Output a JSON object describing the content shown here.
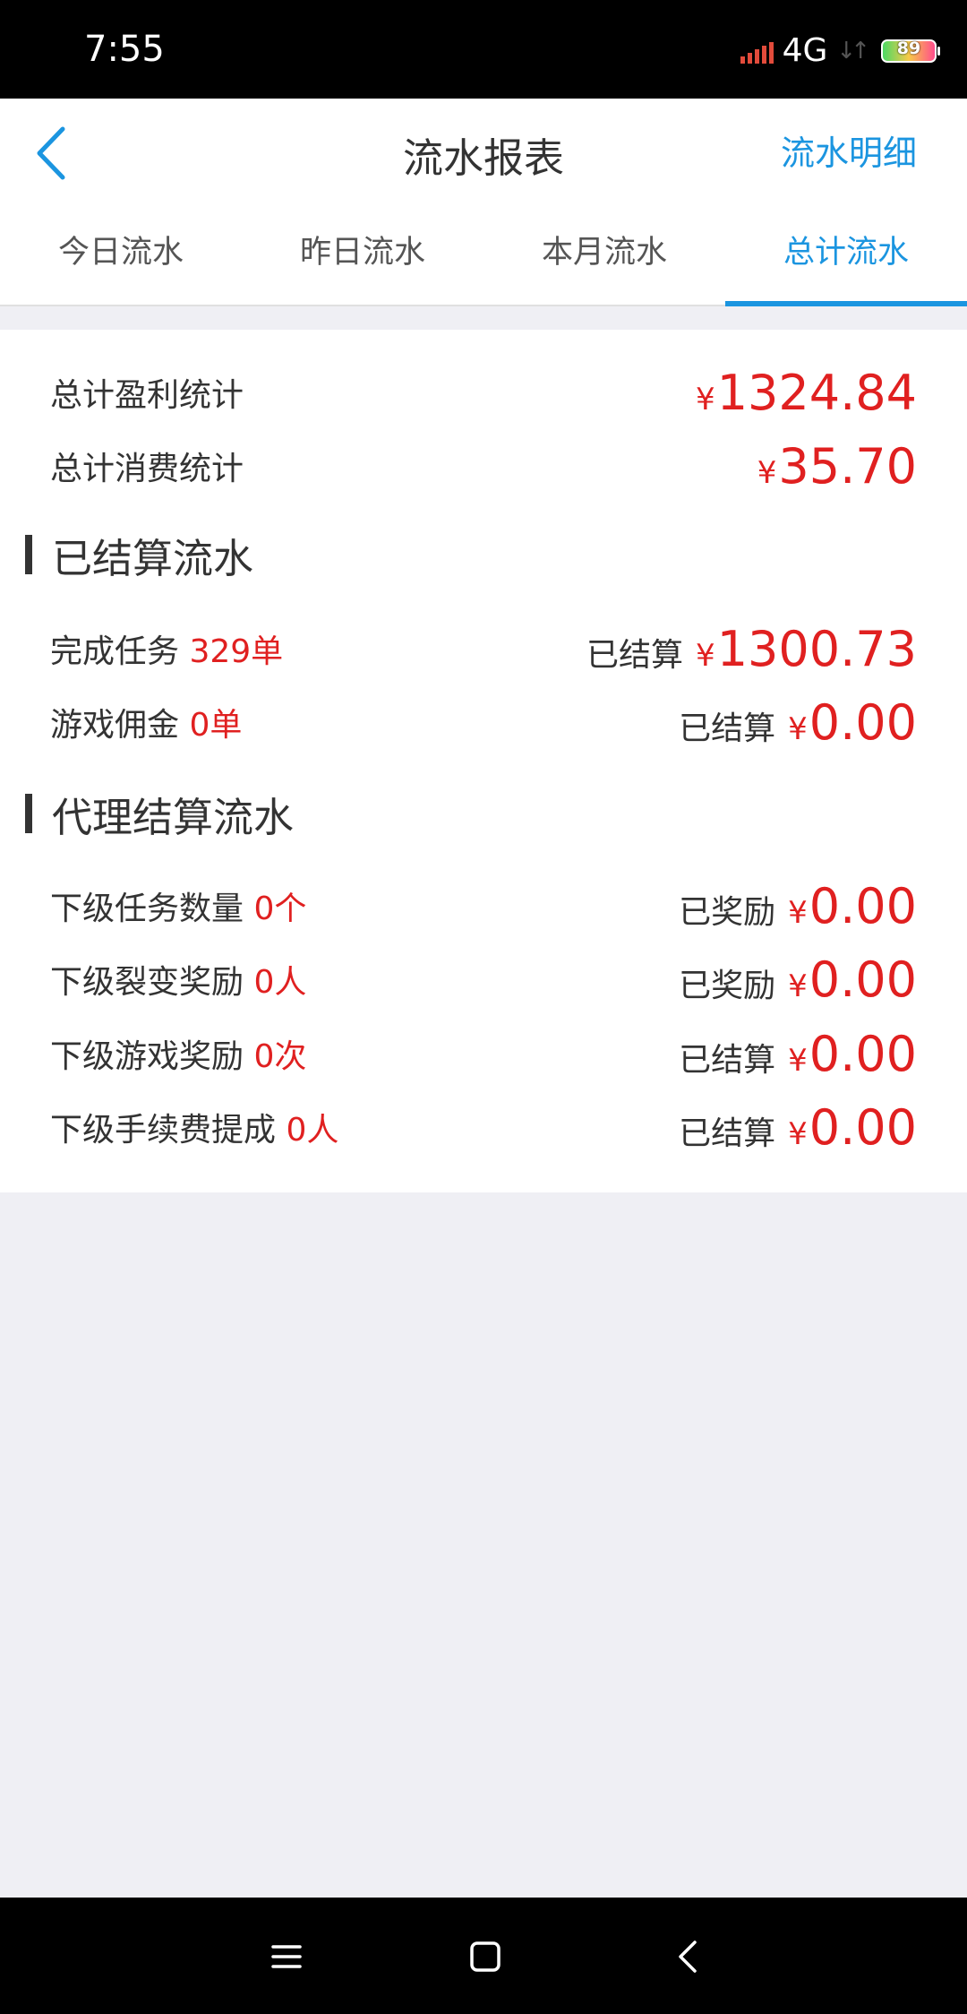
{
  "status_bar": {
    "time": "7:55",
    "network": "4G",
    "battery": "89"
  },
  "header": {
    "title": "流水报表",
    "detail_link": "流水明细",
    "back_icon": "chevron-left-icon"
  },
  "tabs": [
    {
      "label": "今日流水",
      "active": false
    },
    {
      "label": "昨日流水",
      "active": false
    },
    {
      "label": "本月流水",
      "active": false
    },
    {
      "label": "总计流水",
      "active": true
    }
  ],
  "summary": {
    "profit": {
      "label": "总计盈利统计",
      "currency": "¥",
      "amount": "1324.84"
    },
    "consumption": {
      "label": "总计消费统计",
      "currency": "¥",
      "amount": "35.70"
    }
  },
  "settled_section": {
    "title": "已结算流水",
    "rows": [
      {
        "label": "完成任务",
        "count": "329单",
        "status": "已结算",
        "currency": "¥",
        "amount": "1300.73"
      },
      {
        "label": "游戏佣金",
        "count": "0单",
        "status": "已结算",
        "currency": "¥",
        "amount": "0.00"
      }
    ]
  },
  "agent_section": {
    "title": "代理结算流水",
    "rows": [
      {
        "label": "下级任务数量",
        "count": "0个",
        "status": "已奖励",
        "currency": "¥",
        "amount": "0.00"
      },
      {
        "label": "下级裂变奖励",
        "count": "0人",
        "status": "已奖励",
        "currency": "¥",
        "amount": "0.00"
      },
      {
        "label": "下级游戏奖励",
        "count": "0次",
        "status": "已结算",
        "currency": "¥",
        "amount": "0.00"
      },
      {
        "label": "下级手续费提成",
        "count": "0人",
        "status": "已结算",
        "currency": "¥",
        "amount": "0.00"
      }
    ]
  },
  "colors": {
    "accent": "#1b95e0",
    "amount": "#e02020",
    "text": "#333333",
    "page_background": "#efeff4"
  },
  "system_nav": {
    "icons": [
      "menu-icon",
      "home-icon",
      "back-icon"
    ]
  }
}
